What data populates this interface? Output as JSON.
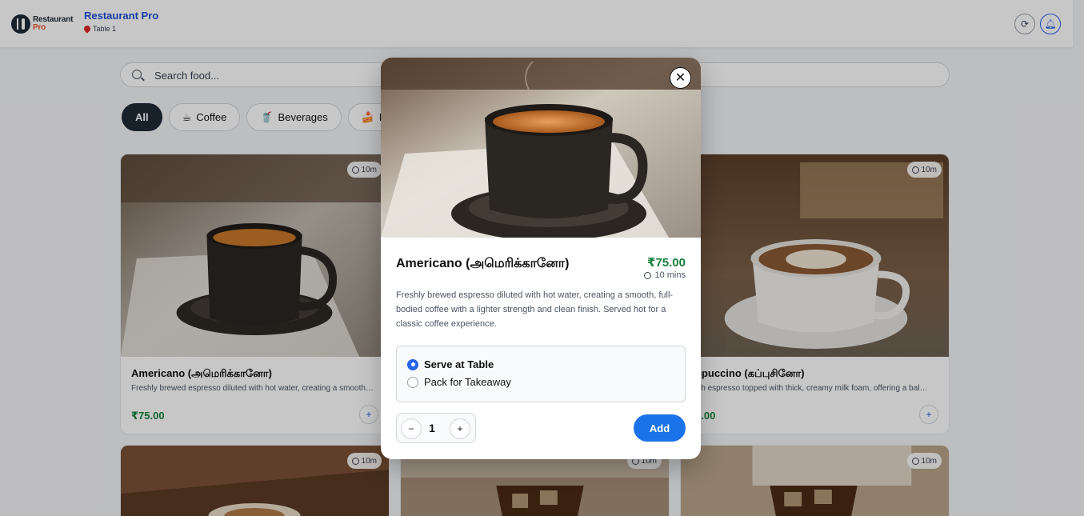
{
  "header": {
    "logo_line1": "Restaurant",
    "logo_line2": "Pro",
    "title": "Restaurant Pro",
    "table": "Table 1"
  },
  "search": {
    "placeholder": "Search food..."
  },
  "categories": [
    {
      "label": "All",
      "emoji": ""
    },
    {
      "label": "Coffee",
      "emoji": "☕"
    },
    {
      "label": "Beverages",
      "emoji": "🥤"
    },
    {
      "label": "D",
      "emoji": "🍰"
    }
  ],
  "cards": [
    {
      "time": "10m",
      "title": "Americano (அமெரிக்கானோ)",
      "desc": "Freshly brewed espresso diluted with hot water, creating a smooth…",
      "price": "₹75.00",
      "add": "+"
    },
    {
      "time": "10m",
      "title": "ppuccino (கப்புசினோ)",
      "desc": "ich espresso topped with thick, creamy milk foam, offering a bal…",
      "price": "5.00",
      "add": "+"
    },
    {
      "time": "10m"
    },
    {
      "time": "10m"
    },
    {
      "time": "10m"
    }
  ],
  "modal": {
    "close": "✕",
    "title": "Americano (அமெரிக்கானோ)",
    "price": "₹75.00",
    "time": "10 mins",
    "description": "Freshly brewed espresso diluted with hot water, creating a smooth, full-bodied coffee with a lighter strength and clean finish. Served hot for a classic coffee experience.",
    "options": [
      "Serve at Table",
      "Pack for Takeaway"
    ],
    "quantity": "1",
    "minus": "−",
    "plus": "+",
    "add_label": "Add"
  },
  "colors": {
    "accent": "#1a73e8",
    "price": "#15803d",
    "brand": "#1d4ed8"
  }
}
